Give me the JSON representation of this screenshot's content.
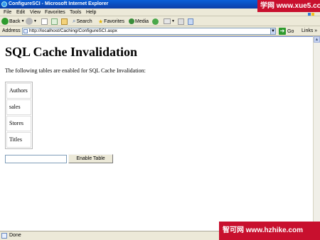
{
  "window": {
    "title": "ConfigureSCI - Microsoft Internet Explorer"
  },
  "watermarks": {
    "top": "学网 www.xue5.com",
    "bottom": "智可网 www.hzhike.com"
  },
  "menu": {
    "items": [
      "File",
      "Edit",
      "View",
      "Favorites",
      "Tools",
      "Help"
    ]
  },
  "toolbar": {
    "back": "Back",
    "search": "Search",
    "favorites": "Favorites",
    "media": "Media"
  },
  "address": {
    "label": "Address",
    "url": "http://localhost/Caching/ConfigureSCI.aspx",
    "go": "Go",
    "links": "Links"
  },
  "page": {
    "heading": "SQL Cache Invalidation",
    "intro": "The following tables are enabled for SQL Cache Invalidation:",
    "tables": [
      "Authors",
      "sales",
      "Stores",
      "Titles"
    ],
    "table_name_value": "",
    "enable_button": "Enable Table"
  },
  "status": {
    "text": "Done"
  }
}
